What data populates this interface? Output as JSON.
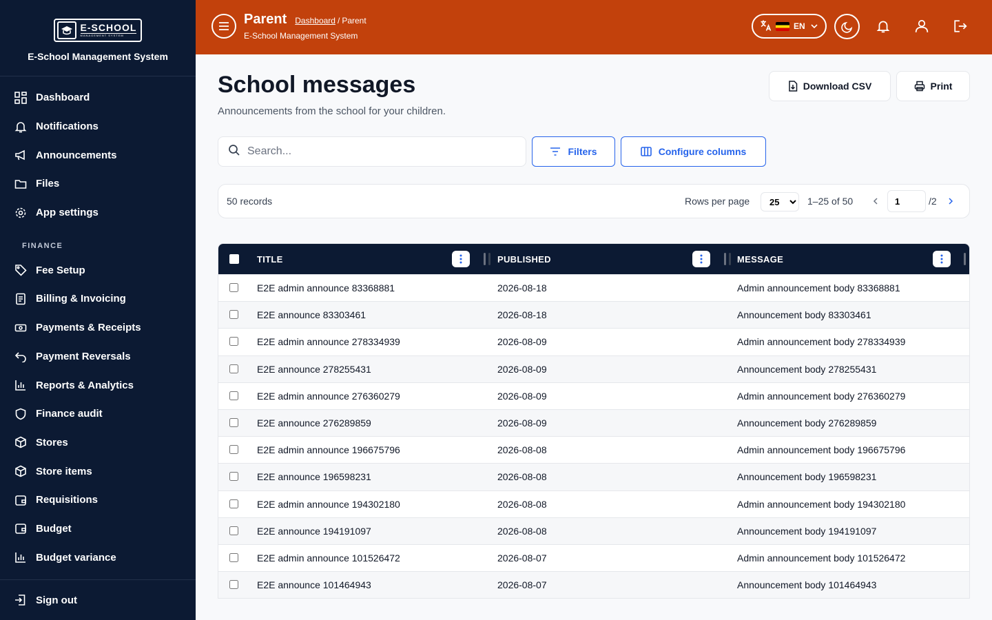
{
  "brand": {
    "logo_main": "E-SCHOOL",
    "logo_sub": "MANAGEMENT SYSTEM",
    "title": "E-School Management System"
  },
  "sidebar": {
    "items": [
      {
        "label": "Dashboard",
        "icon": "dashboard-icon"
      },
      {
        "label": "Notifications",
        "icon": "bell-icon"
      },
      {
        "label": "Announcements",
        "icon": "megaphone-icon"
      },
      {
        "label": "Files",
        "icon": "folder-icon"
      },
      {
        "label": "App settings",
        "icon": "gear-icon"
      }
    ],
    "finance_heading": "FINANCE",
    "finance_items": [
      {
        "label": "Fee Setup",
        "icon": "tag-icon"
      },
      {
        "label": "Billing & Invoicing",
        "icon": "invoice-icon"
      },
      {
        "label": "Payments & Receipts",
        "icon": "cash-icon"
      },
      {
        "label": "Payment Reversals",
        "icon": "undo-icon"
      },
      {
        "label": "Reports & Analytics",
        "icon": "bar-chart-icon"
      },
      {
        "label": "Finance audit",
        "icon": "shield-icon"
      },
      {
        "label": "Stores",
        "icon": "box-icon"
      },
      {
        "label": "Store items",
        "icon": "box-icon"
      },
      {
        "label": "Requisitions",
        "icon": "wallet-icon"
      },
      {
        "label": "Budget",
        "icon": "wallet-icon"
      },
      {
        "label": "Budget variance",
        "icon": "bar-chart-icon"
      }
    ],
    "signout": "Sign out"
  },
  "header": {
    "role": "Parent",
    "crumb_link": "Dashboard",
    "crumb_sep": "/",
    "crumb_current": "Parent",
    "system_name": "E-School Management System",
    "language": "EN",
    "accent": "#c2410c"
  },
  "main": {
    "title": "School messages",
    "subtitle": "Announcements from the school for your children.",
    "download_csv": "Download CSV",
    "print": "Print",
    "search_placeholder": "Search...",
    "filters": "Filters",
    "configure_columns": "Configure columns"
  },
  "pager": {
    "records": "50 records",
    "rows_per_page_label": "Rows per page",
    "rows_per_page": "25",
    "range": "1–25 of 50",
    "page": "1",
    "total_pages": "/2"
  },
  "table": {
    "columns": [
      "TITLE",
      "PUBLISHED",
      "MESSAGE"
    ],
    "rows": [
      [
        "E2E admin announce 83368881",
        "2026-08-18",
        "Admin announcement body 83368881"
      ],
      [
        "E2E announce 83303461",
        "2026-08-18",
        "Announcement body 83303461"
      ],
      [
        "E2E admin announce 278334939",
        "2026-08-09",
        "Admin announcement body 278334939"
      ],
      [
        "E2E announce 278255431",
        "2026-08-09",
        "Announcement body 278255431"
      ],
      [
        "E2E admin announce 276360279",
        "2026-08-09",
        "Admin announcement body 276360279"
      ],
      [
        "E2E announce 276289859",
        "2026-08-09",
        "Announcement body 276289859"
      ],
      [
        "E2E admin announce 196675796",
        "2026-08-08",
        "Admin announcement body 196675796"
      ],
      [
        "E2E announce 196598231",
        "2026-08-08",
        "Announcement body 196598231"
      ],
      [
        "E2E admin announce 194302180",
        "2026-08-08",
        "Admin announcement body 194302180"
      ],
      [
        "E2E announce 194191097",
        "2026-08-08",
        "Announcement body 194191097"
      ],
      [
        "E2E admin announce 101526472",
        "2026-08-07",
        "Admin announcement body 101526472"
      ],
      [
        "E2E announce 101464943",
        "2026-08-07",
        "Announcement body 101464943"
      ]
    ]
  }
}
